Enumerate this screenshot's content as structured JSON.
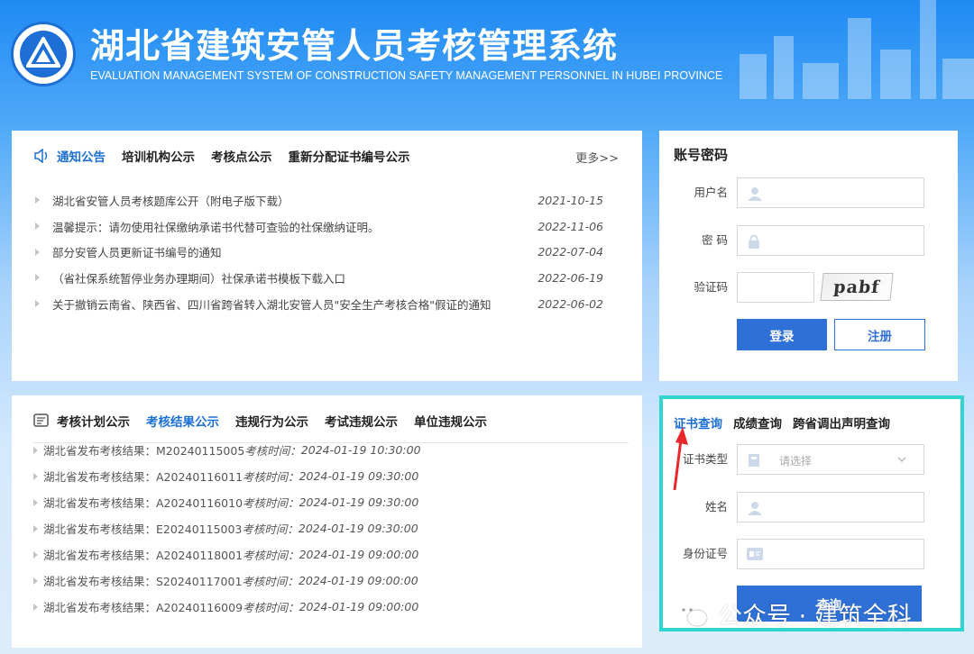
{
  "header": {
    "title": "湖北省建筑安管人员考核管理系统",
    "subtitle": "EVALUATION MANAGEMENT SYSTEM OF CONSTRUCTION SAFETY MANAGEMENT PERSONNEL IN HUBEI PROVINCE"
  },
  "notice": {
    "tabs": [
      "通知公告",
      "培训机构公示",
      "考核点公示",
      "重新分配证书编号公示"
    ],
    "more": "更多>>",
    "items": [
      {
        "text": "湖北省安管人员考核题库公开（附电子版下载）",
        "date": "2021-10-15"
      },
      {
        "text": "温馨提示：请勿使用社保缴纳承诺书代替可查验的社保缴纳证明。",
        "date": "2022-11-06"
      },
      {
        "text": "部分安管人员更新证书编号的通知",
        "date": "2022-07-04"
      },
      {
        "text": "（省社保系统暂停业务办理期间）社保承诺书模板下载入口",
        "date": "2022-06-19"
      },
      {
        "text": "关于撤销云南省、陕西省、四川省跨省转入湖北安管人员\"安全生产考核合格\"假证的通知",
        "date": "2022-06-02"
      }
    ]
  },
  "results": {
    "tabs": [
      "考核计划公示",
      "考核结果公示",
      "违规行为公示",
      "考试违规公示",
      "单位违规公示"
    ],
    "items": [
      {
        "text": "湖北省发布考核结果：M20240115005",
        "time_label": "考核时间：",
        "time": "2024-01-19 10:30:00"
      },
      {
        "text": "湖北省发布考核结果：A20240116011",
        "time_label": "考核时间：",
        "time": "2024-01-19 09:30:00"
      },
      {
        "text": "湖北省发布考核结果：A20240116010",
        "time_label": "考核时间：",
        "time": "2024-01-19 09:30:00"
      },
      {
        "text": "湖北省发布考核结果：E20240115003",
        "time_label": "考核时间：",
        "time": "2024-01-19 09:30:00"
      },
      {
        "text": "湖北省发布考核结果：A20240118001",
        "time_label": "考核时间：",
        "time": "2024-01-19 09:00:00"
      },
      {
        "text": "湖北省发布考核结果：S20240117001",
        "time_label": "考核时间：",
        "time": "2024-01-19 09:00:00"
      },
      {
        "text": "湖北省发布考核结果：A20240116009",
        "time_label": "考核时间：",
        "time": "2024-01-19 09:00:00"
      }
    ]
  },
  "login": {
    "title": "账号密码",
    "username_label": "用户名",
    "password_label": "密 码",
    "captcha_label": "验证码",
    "captcha_text": "pabf",
    "login_button": "登录",
    "register_button": "注册"
  },
  "query": {
    "tabs": [
      "证书查询",
      "成绩查询",
      "跨省调出声明查询"
    ],
    "cert_type_label": "证书类型",
    "cert_type_placeholder": "请选择",
    "name_label": "姓名",
    "id_label": "身份证号",
    "search_button": "查询"
  },
  "watermark": "公众号 · 建筑全科",
  "colors": {
    "accent": "#1d6fd6",
    "highlight_border": "#31d5cf",
    "arrow": "#e8262b"
  }
}
